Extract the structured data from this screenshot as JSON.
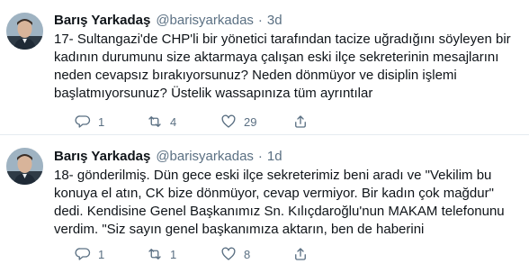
{
  "tweets": [
    {
      "author_name": "Barış Yarkadaş",
      "handle": "@barisyarkadas",
      "separator": "·",
      "time": "3d",
      "lines": [
        "17- Sultangazi'de CHP'li bir yönetici tarafından tacize uğradığını söyleyen bir",
        "kadının durumunu size aktarmaya çalışan eski ilçe sekreterinin mesajlarını",
        "neden cevapsız bırakıyorsunuz? Neden dönmüyor ve disiplin işlemi",
        "başlatmıyorsunuz? Üstelik wassapınıza tüm ayrıntılar"
      ],
      "reply_count": "1",
      "retweet_count": "4",
      "like_count": "29"
    },
    {
      "author_name": "Barış Yarkadaş",
      "handle": "@barisyarkadas",
      "separator": "·",
      "time": "1d",
      "lines": [
        "18- gönderilmiş. Dün gece eski ilçe sekreterimiz beni aradı ve \"Vekilim bu",
        "konuya el atın, CK bize dönmüyor, cevap vermiyor. Bir kadın çok mağdur\"",
        "dedi. Kendisine Genel Başkanımız Sn. Kılıçdaroğlu'nun MAKAM telefonunu",
        "verdim. \"Siz sayın genel başkanımıza aktarın, ben de haberini"
      ],
      "reply_count": "1",
      "retweet_count": "1",
      "like_count": "8"
    }
  ],
  "icons": {
    "reply": "reply-icon",
    "retweet": "retweet-icon",
    "like": "heart-icon",
    "share": "share-icon"
  },
  "colors": {
    "text": "#0f1419",
    "secondary": "#5b7083",
    "divider": "#e6ecf0"
  }
}
